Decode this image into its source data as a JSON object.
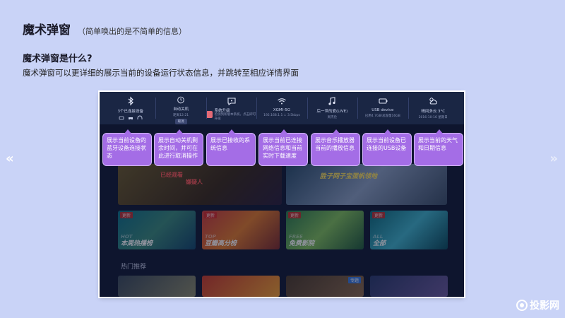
{
  "slide": {
    "title": "魔术弹窗",
    "subtitle": "（简单唤出的是不简单的信息）",
    "question": "魔术弹窗是什么?",
    "description": "魔术弹窗可以更详细的展示当前的设备运行状态信息，并跳转至相应详情界面",
    "nav_prev": "«",
    "nav_next": "»",
    "brand": "投影网"
  },
  "statusbar": {
    "bluetooth": {
      "label": "3个已连接设备",
      "icon": "bluetooth-icon"
    },
    "timer": {
      "label": "自动关机",
      "sub": "距离12:21",
      "button": "取消",
      "icon": "clock-icon"
    },
    "message": {
      "label": "系统升级",
      "sub": "检测到新版本系统，点击即可升级",
      "icon": "message-icon"
    },
    "network": {
      "label": "XGMI-5G",
      "sub": "192.168.1.1 ↓ 3.5kbps",
      "icon": "wifi-icon"
    },
    "music": {
      "label": "后一世的爱(LIVE)",
      "sub": "周杰伦",
      "icon": "music-icon"
    },
    "usb": {
      "label": "USB device",
      "sub": "已用4.7GB/总容量16GB",
      "icon": "usb-icon"
    },
    "weather": {
      "label": "晴间多云 3°C",
      "sub": "2016-10-16 星期日",
      "icon": "weather-icon"
    }
  },
  "content": {
    "row1_left_tag1": "已经观看",
    "row1_left_tag2": "嫌疑人",
    "row1_right_text": "胜子网子宝蛋帆领地",
    "cards": [
      {
        "tag": "更新",
        "big": "HOT",
        "label": "本周热播榜"
      },
      {
        "tag": "更新",
        "big": "TOP",
        "label": "豆瓣高分榜"
      },
      {
        "tag": "更新",
        "big": "FREE",
        "label": "免费影院"
      },
      {
        "tag": "更新",
        "big": "ALL",
        "label": "全部"
      }
    ],
    "section_label": "热门推荐",
    "bottom_tag": "专题"
  },
  "callouts": [
    "展示当前设备的蓝牙设备连接状态",
    "展示自动关机剩余时间，并可在此进行取消操作",
    "展示已接收的系统信息",
    "展示当前已连接网络信息和当前实时下载速度",
    "展示音乐播放器当前的播放信息",
    "展示当前设备已连接的USB设备",
    "展示当前的天气和日期信息"
  ],
  "colors": {
    "background": "#c9d3f7",
    "callout": "#a46de6",
    "screen": "#111a33"
  }
}
